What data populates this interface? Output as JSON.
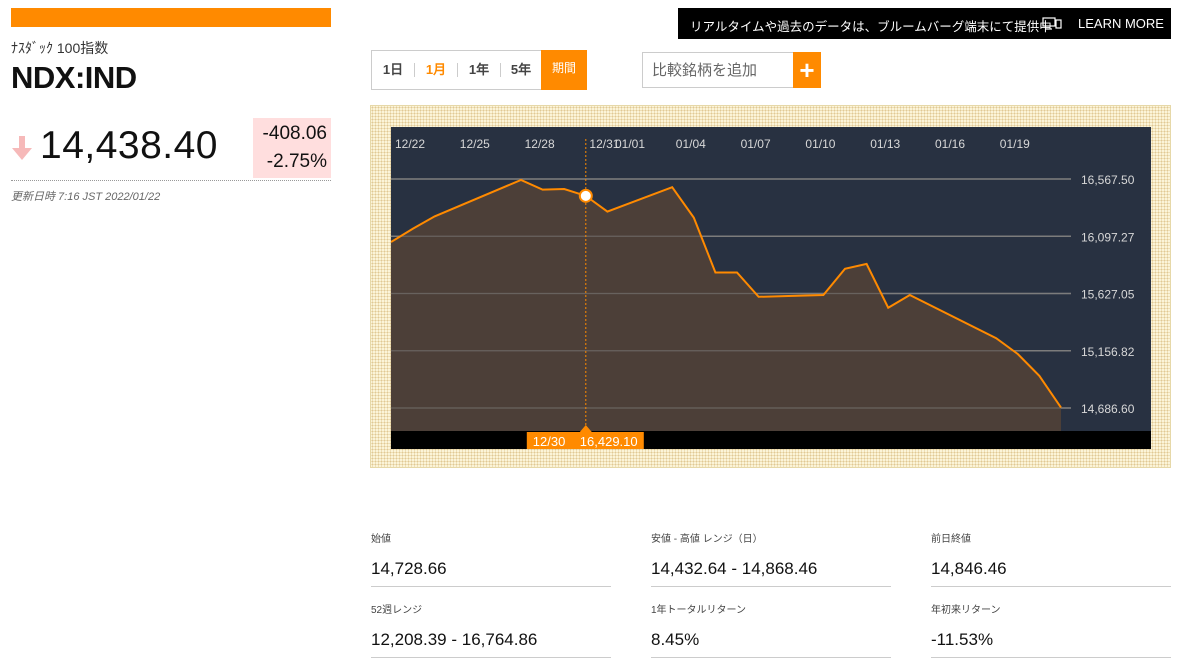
{
  "quote": {
    "index_name": "ﾅｽﾀﾞｯｸ 100指数",
    "ticker": "NDX:IND",
    "price": "14,438.40",
    "change_abs": "-408.06",
    "change_pct": "-2.75%",
    "updated": "更新日時 7:16 JST 2022/01/22"
  },
  "banner": {
    "text": "リアルタイムや過去のデータは、ブルームバーグ端末にて提供中",
    "link": "LEARN MORE"
  },
  "range": {
    "buttons": [
      "1日",
      "1月",
      "1年",
      "5年"
    ],
    "active": "1月",
    "period": "期間"
  },
  "compare": {
    "placeholder": "比較銘柄を追加",
    "add": "+"
  },
  "chart_data": {
    "type": "area",
    "x_ticks": [
      "12/22",
      "12/25",
      "12/28",
      "12/31",
      "01/01",
      "01/04",
      "01/07",
      "01/10",
      "01/13",
      "01/16",
      "01/19"
    ],
    "y_ticks": [
      "16,567.50",
      "16,097.27",
      "15,627.05",
      "15,156.82",
      "14,686.60"
    ],
    "ylim": [
      14686.6,
      16567.5
    ],
    "series": [
      {
        "values": [
          [
            "12/21",
            16050
          ],
          [
            "12/22",
            16160
          ],
          [
            "12/23",
            16260
          ],
          [
            "12/27",
            16560
          ],
          [
            "12/28",
            16480
          ],
          [
            "12/29",
            16485
          ],
          [
            "12/30",
            16429.1
          ],
          [
            "12/31",
            16300
          ],
          [
            "01/03",
            16500
          ],
          [
            "01/04",
            16250
          ],
          [
            "01/05",
            15800
          ],
          [
            "01/06",
            15800
          ],
          [
            "01/07",
            15600
          ],
          [
            "01/10",
            15615
          ],
          [
            "01/11",
            15830
          ],
          [
            "01/12",
            15870
          ],
          [
            "01/13",
            15510
          ],
          [
            "01/14",
            15615
          ],
          [
            "01/18",
            15260
          ],
          [
            "01/19",
            15130
          ],
          [
            "01/20",
            14950
          ],
          [
            "01/21",
            14690
          ]
        ]
      }
    ],
    "tooltip": {
      "date": "12/30",
      "value": "16,429.10"
    },
    "colors": {
      "background": "#283141",
      "fill": "#4e4038",
      "line": "#ff8a00",
      "grid": "#7c7c7c",
      "axis_bar": "#000000"
    },
    "grid": true
  },
  "stats": [
    {
      "label": "始値",
      "value": "14,728.66"
    },
    {
      "label": "安値 - 高値 レンジ（日）",
      "value": "14,432.64 - 14,868.46"
    },
    {
      "label": "前日終値",
      "value": "14,846.46"
    },
    {
      "label": "52週レンジ",
      "value": "12,208.39 - 16,764.86"
    },
    {
      "label": "1年トータルリターン",
      "value": "8.45%"
    },
    {
      "label": "年初来リターン",
      "value": "-11.53%"
    }
  ],
  "colors": {
    "accent": "#ff8a00",
    "negative_bg": "#ffdede",
    "banner_bg": "#000000"
  },
  "icons": {
    "price_direction": "arrow-down-icon",
    "banner": "monitor-icon"
  }
}
